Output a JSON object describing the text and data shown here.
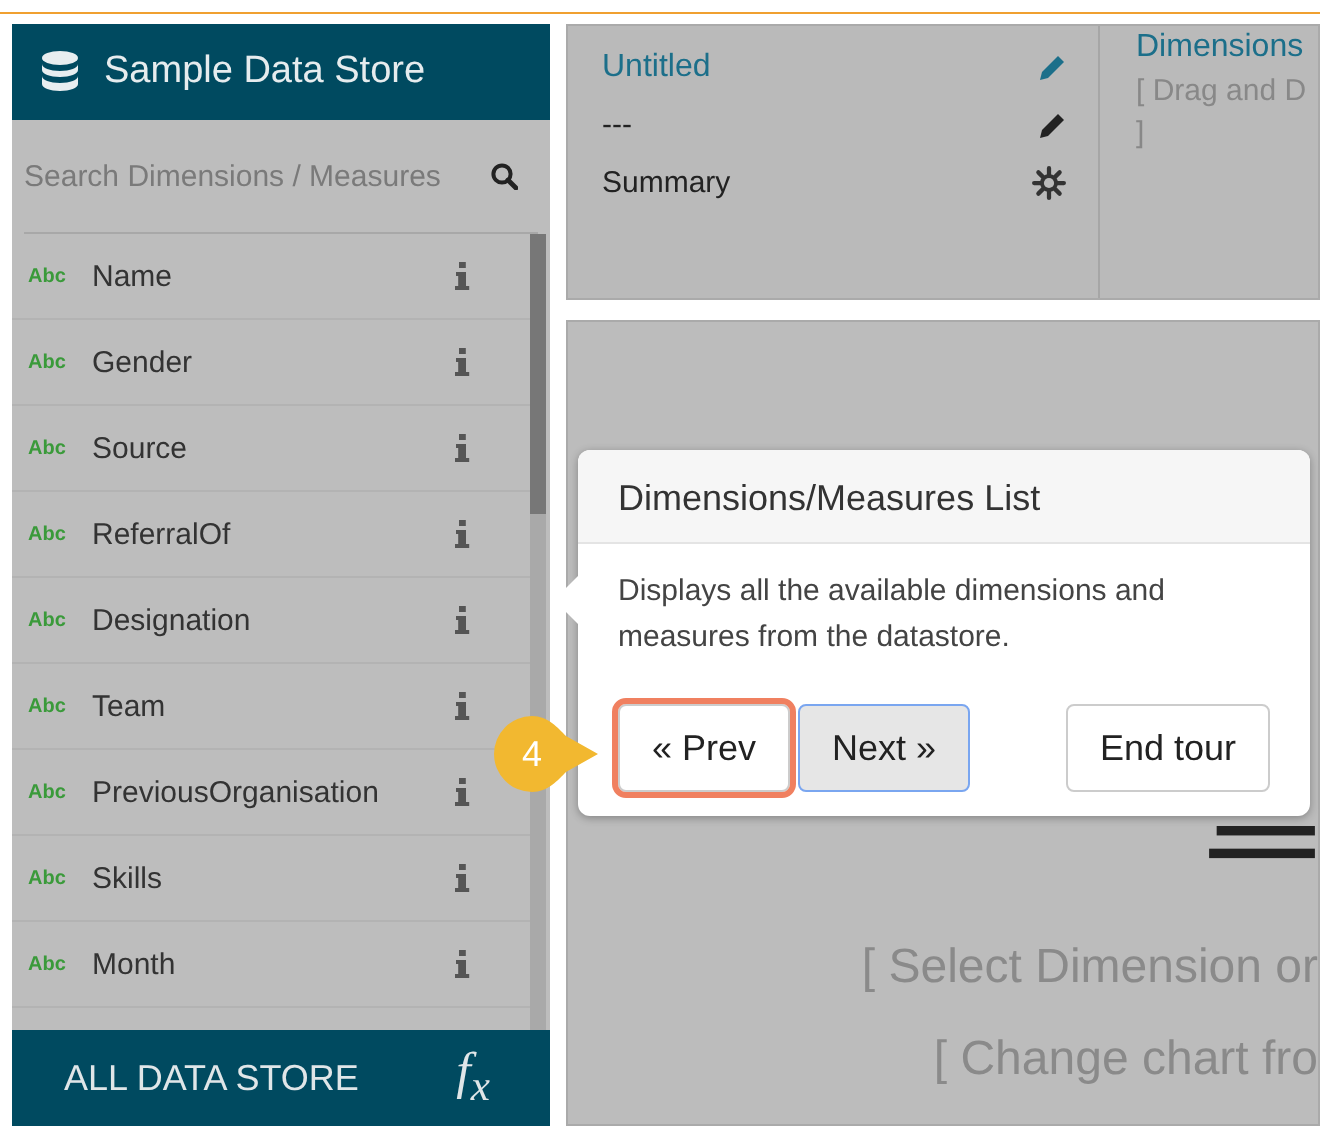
{
  "sidebar": {
    "title": "Sample Data Store",
    "search": {
      "placeholder": "Search Dimensions / Measures"
    },
    "items": [
      {
        "type_tag": "Abc",
        "label": "Name"
      },
      {
        "type_tag": "Abc",
        "label": "Gender"
      },
      {
        "type_tag": "Abc",
        "label": "Source"
      },
      {
        "type_tag": "Abc",
        "label": "ReferralOf"
      },
      {
        "type_tag": "Abc",
        "label": "Designation"
      },
      {
        "type_tag": "Abc",
        "label": "Team"
      },
      {
        "type_tag": "Abc",
        "label": "PreviousOrganisation"
      },
      {
        "type_tag": "Abc",
        "label": "Skills"
      },
      {
        "type_tag": "Abc",
        "label": "Month"
      }
    ],
    "footer": {
      "label": "ALL DATA STORE",
      "formula": "f$_{x}$"
    }
  },
  "chart_card": {
    "title": "Untitled",
    "subtitle": "---",
    "summary": "Summary"
  },
  "dimensions": {
    "title": "Dimensions",
    "hint_lines": [
      "[ Drag and D",
      "]"
    ]
  },
  "canvas": {
    "messages": [
      "[ Select Dimension or",
      "[ Change chart fro"
    ]
  },
  "tour": {
    "step": "4",
    "title": "Dimensions/Measures List",
    "body": "Displays all the available dimensions and measures from the datastore.",
    "buttons": [
      {
        "label": "« Prev",
        "highlighted": true,
        "focused": false
      },
      {
        "label": "Next »",
        "highlighted": false,
        "focused": true
      },
      {
        "label": "End tour",
        "highlighted": false,
        "focused": false
      }
    ]
  }
}
